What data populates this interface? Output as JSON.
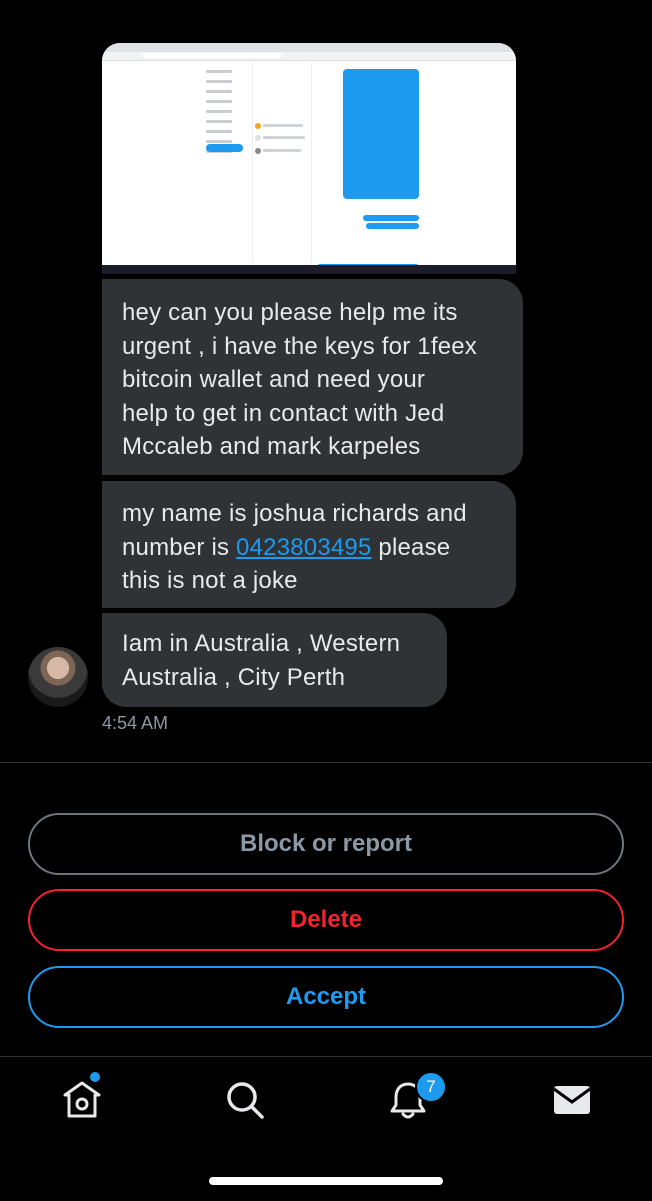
{
  "messages": [
    {
      "lines": [
        "hey can you please help me its",
        "urgent , i have the keys for 1feex",
        "bitcoin wallet and need your",
        "help to get in contact with Jed",
        "Mccaleb and mark karpeles"
      ]
    },
    {
      "line1": "my name is joshua richards and",
      "line2_pre": "number is ",
      "phone": "0423803495",
      "line2_post": " please",
      "line3": "this is not a joke"
    },
    {
      "lines": [
        "Iam in Australia , Western",
        "Australia , City Perth"
      ]
    }
  ],
  "timestamp": "4:54 AM",
  "actions": {
    "block": "Block or report",
    "delete": "Delete",
    "accept": "Accept"
  },
  "nav": {
    "notifications_count": "7"
  },
  "colors": {
    "accent": "#1d9bf0",
    "danger": "#f4212e",
    "bubble": "#2f3336"
  }
}
